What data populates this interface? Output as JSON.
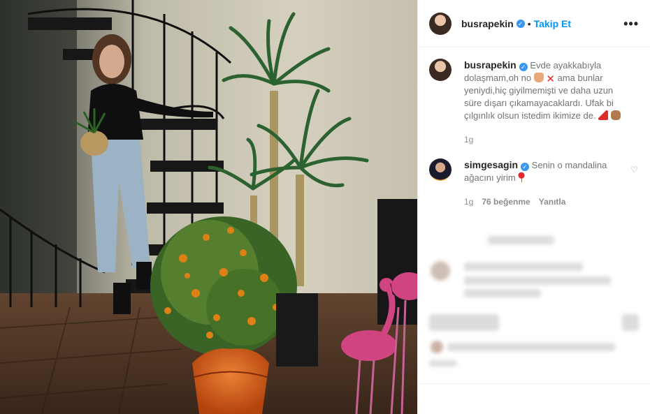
{
  "post": {
    "author": "busrapekin",
    "follow_label": "Takip Et",
    "more_label": "•••"
  },
  "caption": {
    "username": "busrapekin",
    "text_1": "Evde ayakkabıyla dolaşmam,oh no",
    "text_2": "ama bunlar yeniydi,hiç giyilmemişti ve daha uzun süre dışarı çıkamayacaklardı. Ufak bi çılgınlık olsun istedim ikimize de.",
    "time": "1g"
  },
  "comments": [
    {
      "username": "simgesagin",
      "text": "Senin o mandalina ağacını yirim",
      "time": "1g",
      "likes": "76 beğenme",
      "reply_label": "Yanıtla"
    }
  ],
  "icons": {
    "verified": "verified-badge-icon",
    "heart": "heart-outline-icon",
    "more": "more-horizontal-icon"
  },
  "colors": {
    "accent": "#0095f6",
    "verified": "#3897f0",
    "muted": "#8e8e8e"
  }
}
